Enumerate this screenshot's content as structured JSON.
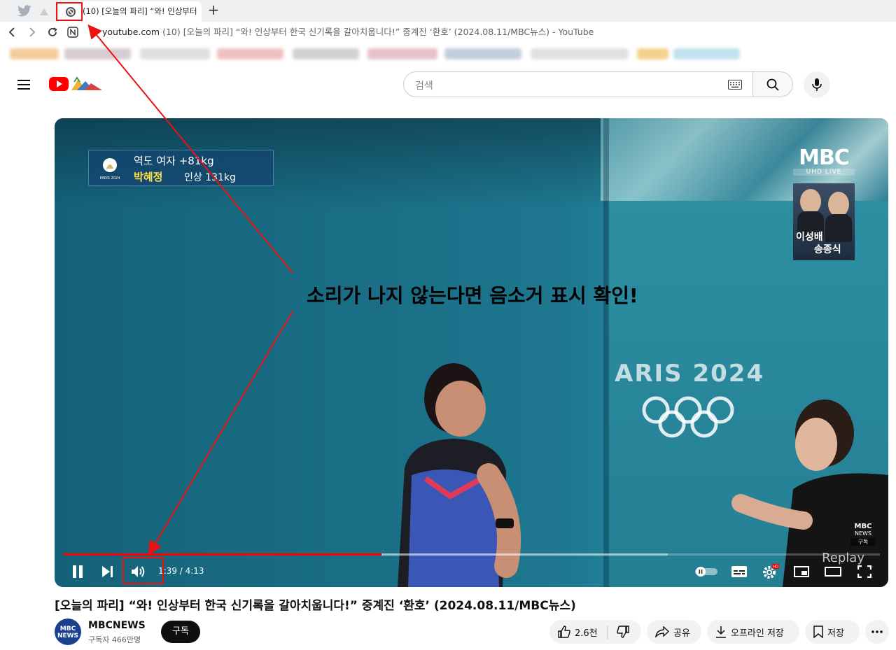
{
  "browser": {
    "tab": {
      "title": "(10) [오늘의 파리] “와! 인상부터"
    },
    "url": {
      "host": "youtube.com",
      "rest": " (10) [오늘의 파리] “와! 인상부터 한국 신기록을 갈아치웁니다!” 중계진 ‘환호’ (2024.08.11/MBC뉴스) - YouTube"
    }
  },
  "masthead": {
    "search_placeholder": "검색"
  },
  "player": {
    "caption": {
      "line1": "역도 여자 +81kg",
      "name": "박혜정",
      "rest": "인상 131kg",
      "logo_text": "PARIS 2024"
    },
    "mbc": {
      "big": "MBC",
      "small": "UHD LIVE"
    },
    "anchors": [
      "이성배",
      "송종식"
    ],
    "venue_text": "ARIS 2024",
    "annotation": "소리가 나지 않는다면 음소거 표시 확인!",
    "watermark": {
      "line1": "MBC",
      "line2": "NEWS",
      "line3": "구독"
    },
    "replay": "Replay",
    "time": "1:39 / 4:13",
    "progress_played": 0.39,
    "progress_buffered": 0.74
  },
  "video": {
    "title": "[오늘의 파리] “와! 인상부터 한국 신기록을 갈아치웁니다!” 중계진 ‘환호’ (2024.08.11/MBC뉴스)",
    "channel": {
      "name": "MBCNEWS",
      "subs": "구독자 466만명",
      "avatar_line1": "MBC",
      "avatar_line2": "NEWS"
    },
    "subscribe": "구독",
    "actions": {
      "likes": "2.6천",
      "share": "공유",
      "download": "오프라인 저장",
      "save": "저장"
    }
  },
  "colors": {
    "accent": "#ff0000",
    "annotation": "#e11111"
  }
}
